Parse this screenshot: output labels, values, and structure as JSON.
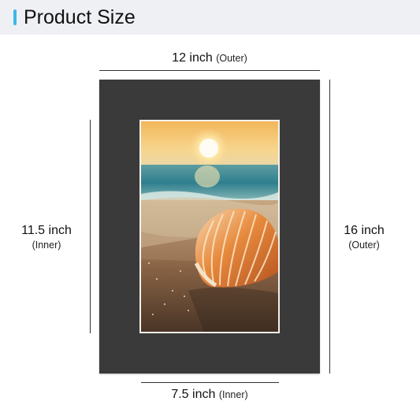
{
  "header": {
    "title": "Product Size",
    "accent_color": "#3fb6e8"
  },
  "dimensions": {
    "top": {
      "value": "12 inch",
      "note": "(Outer)"
    },
    "left": {
      "value": "11.5 inch",
      "note": "(Inner)"
    },
    "right": {
      "value": "16 inch",
      "note": "(Outer)"
    },
    "bottom": {
      "value": "7.5 inch",
      "note": "(Inner)"
    }
  },
  "frame": {
    "mat_color": "#3b3a3a",
    "photo_subject": "seashell-on-beach-at-sunset"
  }
}
